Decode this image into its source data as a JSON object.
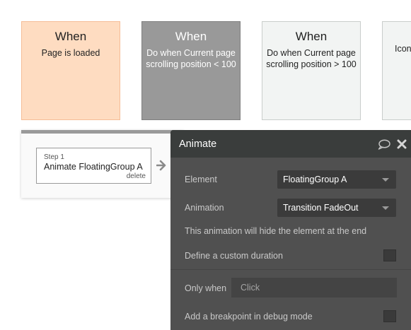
{
  "events": [
    {
      "when": "When",
      "description": "Page is loaded"
    },
    {
      "when": "When",
      "description": "Do when Current page scrolling position < 100"
    },
    {
      "when": "When",
      "description": "Do when Current page scrolling position > 100"
    },
    {
      "when": "",
      "description": "Icon cir"
    }
  ],
  "workflow": {
    "step_number": "Step 1",
    "step_action": "Animate FloatingGroup A",
    "delete_label": "delete"
  },
  "animate_panel": {
    "title": "Animate",
    "element_label": "Element",
    "element_value": "FloatingGroup A",
    "animation_label": "Animation",
    "animation_value": "Transition FadeOut",
    "info_text": "This animation will hide the element at the end",
    "custom_duration_label": "Define a custom duration",
    "only_when_label": "Only when",
    "only_when_placeholder": "Click",
    "breakpoint_label": "Add a breakpoint in debug mode"
  },
  "colors": {
    "event_loaded_bg": "#fedcc1",
    "event_selected_bg": "#999999",
    "event_default_bg": "#f2f4f3",
    "panel_bg": "#505050",
    "panel_header_bg": "#3a3d3c"
  },
  "icons": [
    "arrow-right-icon",
    "comment-icon",
    "close-icon",
    "chevron-down-icon"
  ]
}
